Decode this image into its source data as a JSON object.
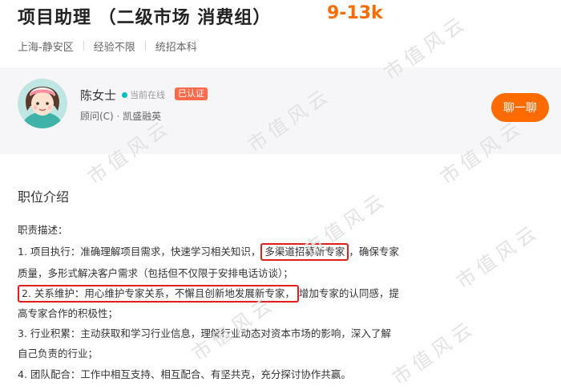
{
  "job": {
    "title": "项目助理 （二级市场 消费组）",
    "salary": "9-13k",
    "tags": [
      "上海-静安区",
      "经验不限",
      "统招本科"
    ]
  },
  "recruiter": {
    "name": "陈女士",
    "status": "当前在线",
    "badge": "已认证",
    "position_company": "顾问(C) · 凯盛融英",
    "chat_label": "聊一聊"
  },
  "description": {
    "section_title": "职位介绍",
    "heading": "职责描述：",
    "item1_a": "1. 项目执行：准确理解项目需求，快速学习相关知识，",
    "item1_highlight": "多渠道招募新专家",
    "item1_b": "，确保专家",
    "item1_c": "质量，多形式解决客户需求（包括但不仅限于安排电话访谈）；",
    "item2_highlight": "2. 关系维护：用心维护专家关系，不懈且创新地发展新专家，",
    "item2_b": "增加专家的认同感，提",
    "item2_c": "高专家合作的积极性；",
    "item3_a": "3. 行业积累：主动获取和学习行业信息，理解行业动态对资本市场的影响，深入了解",
    "item3_b": "自己负责的行业；",
    "item4": "4. 团队配合：工作中相互支持、相互配合、有坚共克，充分探讨协作共赢。"
  },
  "watermark": "市值风云",
  "colors": {
    "accent": "#ff6b00",
    "badge": "#ff6b4a",
    "online": "#00bebd",
    "highlight_border": "#e02020"
  }
}
